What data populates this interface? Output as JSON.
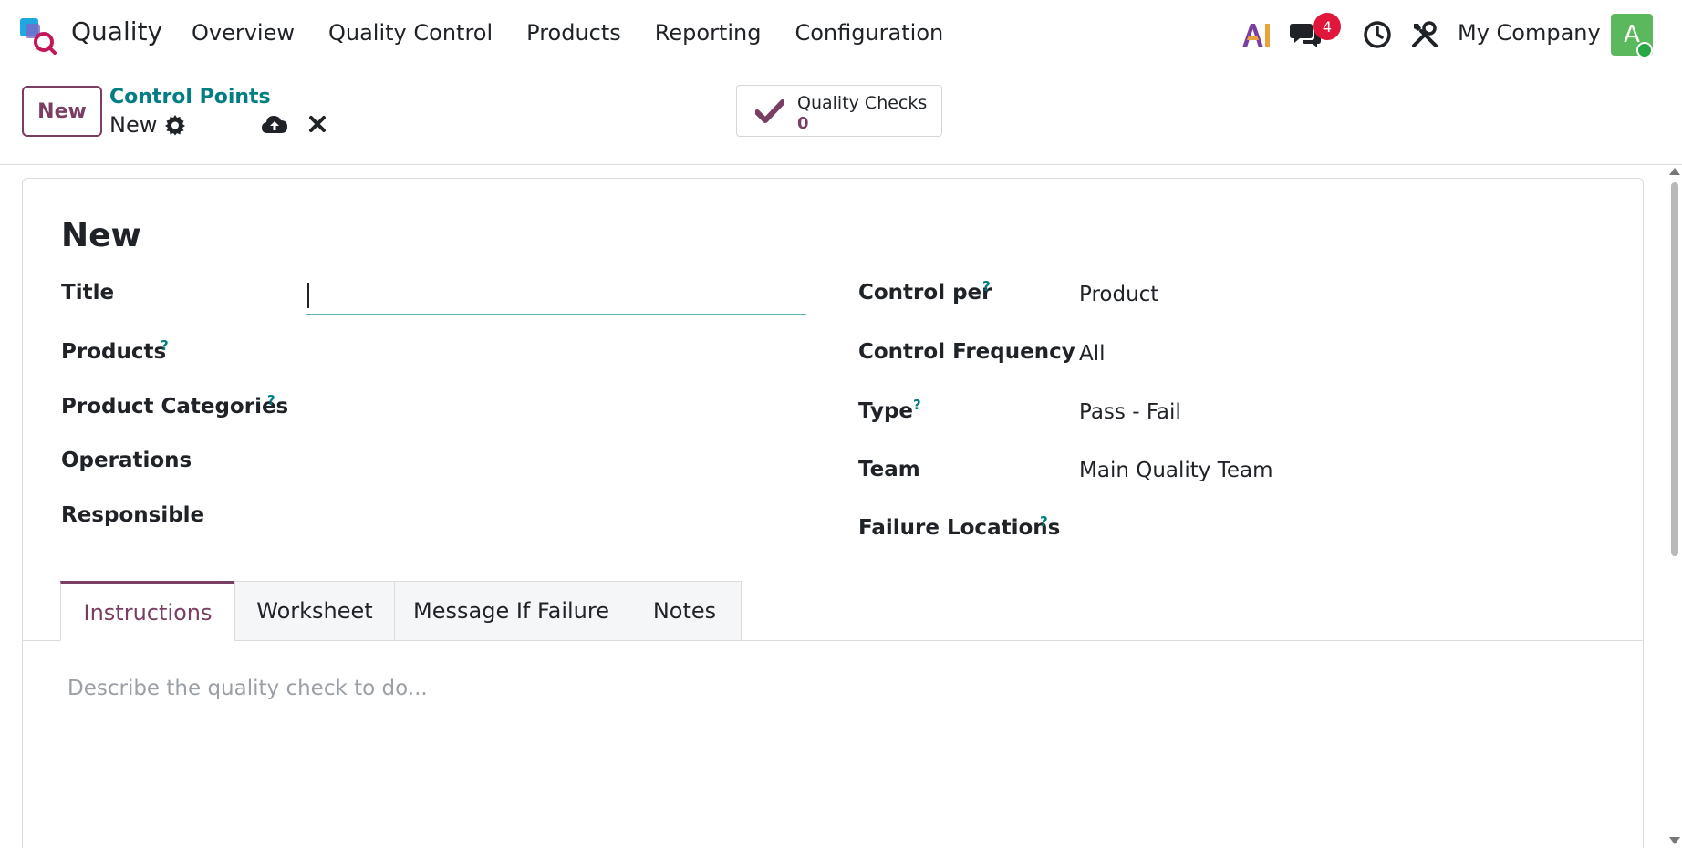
{
  "navbar": {
    "app_name": "Quality",
    "menu": [
      "Overview",
      "Quality Control",
      "Products",
      "Reporting",
      "Configuration"
    ],
    "chat_badge": "4",
    "company": "My Company",
    "avatar_letter": "A"
  },
  "control_panel": {
    "new_button": "New",
    "breadcrumb_parent": "Control Points",
    "breadcrumb_current": "New",
    "smart_button": {
      "label": "Quality Checks",
      "value": "0"
    }
  },
  "form": {
    "record_title": "New",
    "left_fields": {
      "title_label": "Title",
      "title_value": "",
      "products_label": "Products",
      "product_categories_label": "Product Categories",
      "operations_label": "Operations",
      "responsible_label": "Responsible"
    },
    "right_fields": {
      "control_per_label": "Control per",
      "control_per_value": "Product",
      "control_frequency_label": "Control Frequency",
      "control_frequency_value": "All",
      "type_label": "Type",
      "type_value": "Pass - Fail",
      "team_label": "Team",
      "team_value": "Main Quality Team",
      "failure_locations_label": "Failure Locations"
    },
    "help_mark": "?",
    "tabs": [
      "Instructions",
      "Worksheet",
      "Message If Failure",
      "Notes"
    ],
    "instructions_placeholder": "Describe the quality check to do..."
  },
  "colors": {
    "brand": "#7a3e63",
    "link": "#017e84",
    "badge": "#e0173a",
    "avatar": "#5cb85c"
  },
  "icons": [
    "app-logo-icon",
    "ai-icon",
    "chat-icon",
    "clock-icon",
    "tools-icon",
    "gear-icon",
    "cloud-upload-icon",
    "close-icon",
    "checkmark-icon"
  ]
}
